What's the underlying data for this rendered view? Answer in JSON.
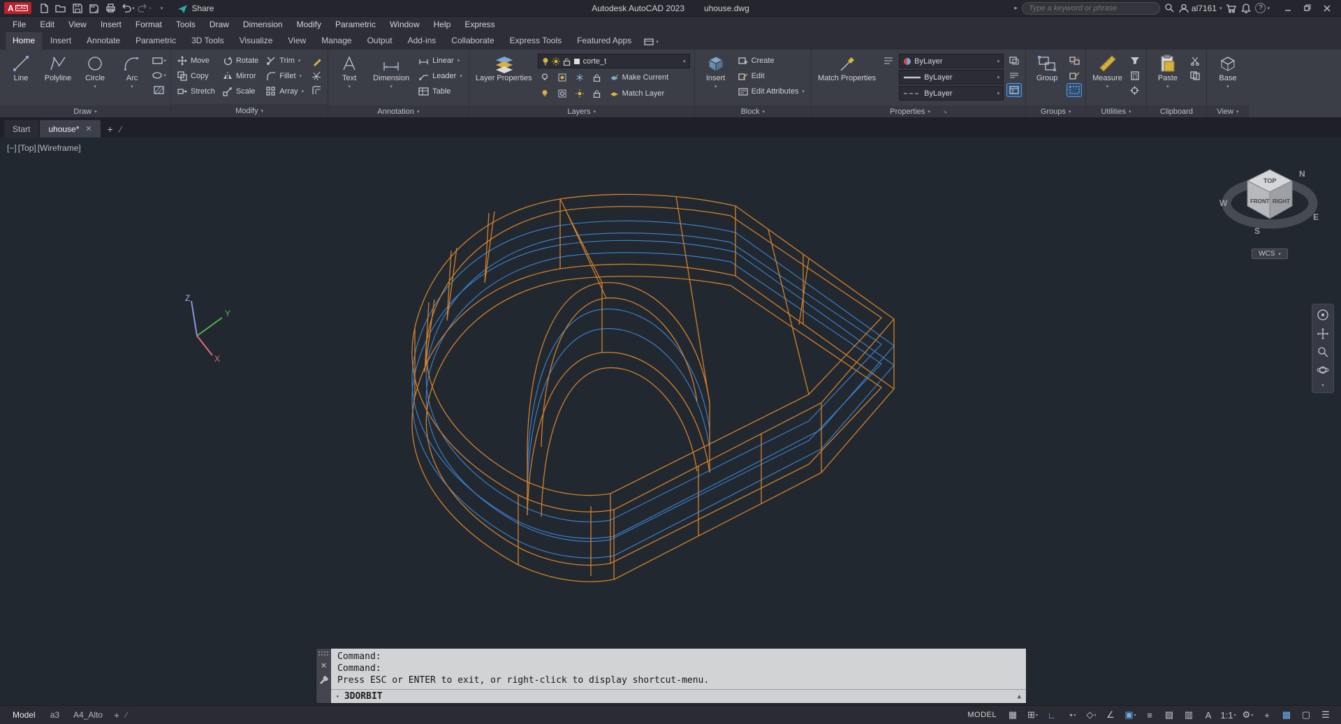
{
  "colors": {
    "wire_orange": "#d4812a",
    "wire_blue": "#3d7ec8",
    "highlight_blue": "#5a9ae0",
    "viewport_bg": "#212830"
  },
  "title_bar": {
    "logo_a": "A",
    "logo_cad": "CAD",
    "share_label": "Share",
    "app_name": "Autodesk AutoCAD 2023",
    "doc_name": "uhouse.dwg",
    "search_placeholder": "Type a keyword or phrase",
    "username": "al7161",
    "help_label": "?"
  },
  "menu": {
    "items": [
      "File",
      "Edit",
      "View",
      "Insert",
      "Format",
      "Tools",
      "Draw",
      "Dimension",
      "Modify",
      "Parametric",
      "Window",
      "Help",
      "Express"
    ]
  },
  "ribbon": {
    "tabs": [
      {
        "label": "Home",
        "active": true
      },
      {
        "label": "Insert"
      },
      {
        "label": "Annotate"
      },
      {
        "label": "Parametric"
      },
      {
        "label": "3D Tools"
      },
      {
        "label": "Visualize"
      },
      {
        "label": "View"
      },
      {
        "label": "Manage"
      },
      {
        "label": "Output"
      },
      {
        "label": "Add-ins"
      },
      {
        "label": "Collaborate"
      },
      {
        "label": "Express Tools"
      },
      {
        "label": "Featured Apps"
      }
    ],
    "draw": {
      "line": "Line",
      "polyline": "Polyline",
      "circle": "Circle",
      "arc": "Arc",
      "footer": "Draw"
    },
    "modify": {
      "move": "Move",
      "copy": "Copy",
      "stretch": "Stretch",
      "rotate": "Rotate",
      "mirror": "Mirror",
      "scale": "Scale",
      "trim": "Trim",
      "fillet": "Fillet",
      "array": "Array",
      "footer": "Modify"
    },
    "annotation": {
      "text": "Text",
      "dimension": "Dimension",
      "linear": "Linear",
      "leader": "Leader",
      "table": "Table",
      "footer": "Annotation"
    },
    "layers": {
      "layer_properties": "Layer Properties",
      "current_layer": "corte_t",
      "make_current": "Make Current",
      "match_layer": "Match Layer",
      "footer": "Layers"
    },
    "block": {
      "insert": "Insert",
      "create": "Create",
      "edit": "Edit",
      "edit_attributes": "Edit Attributes",
      "footer": "Block"
    },
    "properties": {
      "match_properties": "Match Properties",
      "color_value": "ByLayer",
      "lineweight_value": "ByLayer",
      "linetype_value": "ByLayer",
      "footer": "Properties"
    },
    "groups": {
      "group": "Group",
      "footer": "Groups"
    },
    "utilities": {
      "measure": "Measure",
      "footer": "Utilities"
    },
    "clipboard": {
      "paste": "Paste",
      "footer": "Clipboard"
    },
    "view": {
      "base": "Base",
      "footer": "View"
    }
  },
  "file_tabs": {
    "start": "Start",
    "doc": "uhouse*"
  },
  "viewport": {
    "controls": [
      "[−]",
      "[Top]",
      "[Wireframe]"
    ],
    "axes": {
      "x": "X",
      "y": "Y",
      "z": "Z"
    },
    "cube": {
      "top": "TOP",
      "front": "FRONT",
      "right": "RIGHT"
    },
    "compass": {
      "n": "N",
      "e": "E",
      "s": "S",
      "w": "W"
    },
    "wcs": "WCS"
  },
  "command": {
    "lines": [
      "Command:",
      "Command:",
      "Press ESC or ENTER to exit, or right-click to display shortcut-menu."
    ],
    "current": "3DORBIT"
  },
  "status": {
    "model_tab": "Model",
    "layout_tabs": [
      "a3",
      "A4_Alto"
    ],
    "model_space": "MODEL",
    "icons": [
      {
        "name": "grid-display-icon",
        "glyph": "▦"
      },
      {
        "name": "snap-mode-icon",
        "glyph": "⊞",
        "arrow": "▾"
      },
      {
        "name": "ortho-mode-icon",
        "glyph": "∟",
        "blue": true
      },
      {
        "name": "polar-tracking-icon",
        "glyph": "◔",
        "arrow": "▾"
      },
      {
        "name": "isodraft-icon",
        "glyph": "◇",
        "arrow": "▾"
      },
      {
        "name": "object-snap-tracking-icon",
        "glyph": "∠"
      },
      {
        "name": "object-snap-icon",
        "glyph": "▣",
        "blue": true,
        "arrow": "▾"
      },
      {
        "name": "lineweight-display-icon",
        "glyph": "≡"
      },
      {
        "name": "transparency-icon",
        "glyph": "▨"
      },
      {
        "name": "selection-cycling-icon",
        "glyph": "▥"
      },
      {
        "name": "annotation-visibility-icon",
        "glyph": "A"
      },
      {
        "name": "annotation-scale-icon",
        "glyph": "1:1",
        "arrow": "▾"
      },
      {
        "name": "workspace-switching-icon",
        "glyph": "⚙",
        "arrow": "▾"
      },
      {
        "name": "isolate-objects-icon",
        "glyph": "+"
      },
      {
        "name": "graphics-performance-icon",
        "glyph": "▩",
        "blue": true
      },
      {
        "name": "clean-screen-icon",
        "glyph": "▢"
      },
      {
        "name": "customization-icon",
        "glyph": "☰"
      }
    ]
  }
}
